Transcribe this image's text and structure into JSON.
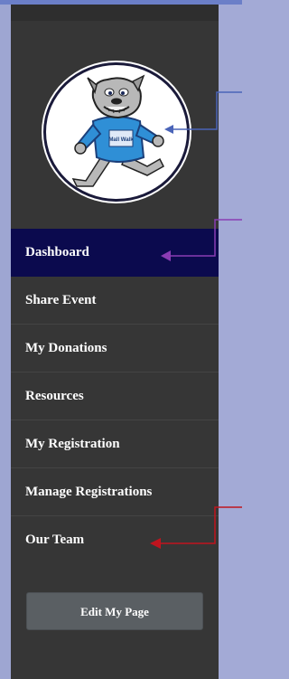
{
  "logo": {
    "icon": "bulldog-mascot-icon",
    "shirt_text": "Mall Walk"
  },
  "nav": {
    "items": [
      {
        "label": "Dashboard",
        "active": true
      },
      {
        "label": "Share Event",
        "active": false
      },
      {
        "label": "My Donations",
        "active": false
      },
      {
        "label": "Resources",
        "active": false
      },
      {
        "label": "My Registration",
        "active": false
      },
      {
        "label": "Manage Registrations",
        "active": false
      },
      {
        "label": "Our Team",
        "active": false
      }
    ]
  },
  "edit_button": {
    "label": "Edit My Page"
  },
  "colors": {
    "sidebar": "#363636",
    "active_item": "#0b0a4e",
    "background": "#a3aad6",
    "arrow_blue": "#4a64b8",
    "arrow_purple": "#8a3cb4",
    "arrow_red": "#c0141e"
  }
}
